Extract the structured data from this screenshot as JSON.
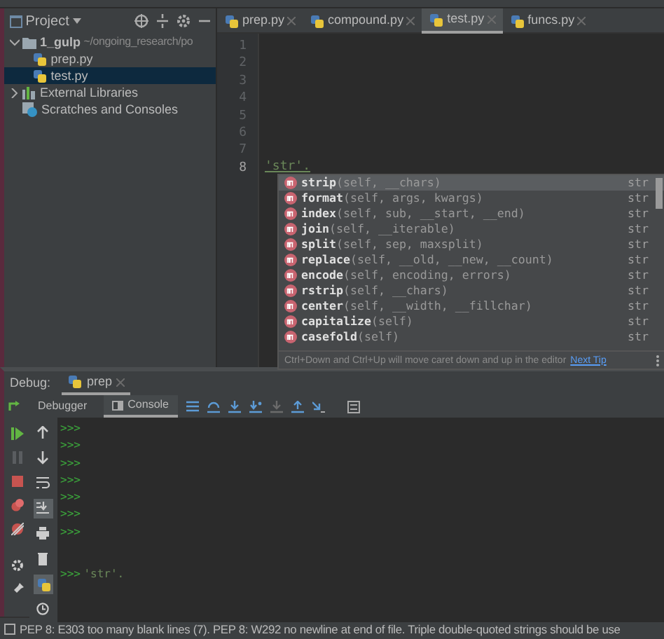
{
  "project_panel": {
    "title": "Project",
    "tree": [
      {
        "label": "1_gulp",
        "path": "~/ongoing_research/po",
        "kind": "folder",
        "expanded": true,
        "selected": false,
        "children": [
          {
            "label": "prep.py",
            "kind": "python",
            "selected": false
          },
          {
            "label": "test.py",
            "kind": "python",
            "selected": true
          }
        ]
      },
      {
        "label": "External Libraries",
        "kind": "library",
        "expanded": false,
        "selected": false
      },
      {
        "label": "Scratches and Consoles",
        "kind": "scratch",
        "selected": false
      }
    ]
  },
  "editor_tabs": [
    {
      "label": "prep.py",
      "selected": false
    },
    {
      "label": "compound.py",
      "selected": false
    },
    {
      "label": "test.py",
      "selected": true
    },
    {
      "label": "funcs.py",
      "selected": false
    }
  ],
  "editor": {
    "line_numbers": [
      "1",
      "2",
      "3",
      "4",
      "5",
      "6",
      "7",
      "8"
    ],
    "code": "'str'."
  },
  "completion": {
    "items": [
      {
        "name": "strip",
        "params": "(self, __chars)",
        "type": "str",
        "selected": true
      },
      {
        "name": "format",
        "params": "(self, args, kwargs)",
        "type": "str",
        "selected": false
      },
      {
        "name": "index",
        "params": "(self, sub, __start, __end)",
        "type": "str",
        "selected": false
      },
      {
        "name": "join",
        "params": "(self, __iterable)",
        "type": "str",
        "selected": false
      },
      {
        "name": "split",
        "params": "(self, sep, maxsplit)",
        "type": "str",
        "selected": false
      },
      {
        "name": "replace",
        "params": "(self, __old, __new, __count)",
        "type": "str",
        "selected": false
      },
      {
        "name": "encode",
        "params": "(self, encoding, errors)",
        "type": "str",
        "selected": false
      },
      {
        "name": "rstrip",
        "params": "(self, __chars)",
        "type": "str",
        "selected": false
      },
      {
        "name": "center",
        "params": "(self, __width, __fillchar)",
        "type": "str",
        "selected": false
      },
      {
        "name": "capitalize",
        "params": "(self)",
        "type": "str",
        "selected": false
      },
      {
        "name": "casefold",
        "params": "(self)",
        "type": "str",
        "selected": false
      }
    ],
    "hint": "Ctrl+Down and Ctrl+Up will move caret down and up in the editor",
    "hint_link": "Next Tip"
  },
  "debug": {
    "label": "Debug:",
    "session": "prep",
    "tabs": [
      {
        "label": "Debugger",
        "selected": false
      },
      {
        "label": "Console",
        "selected": true
      }
    ],
    "console_lines": [
      ">>>",
      ">>>",
      ">>>",
      ">>>",
      ">>>",
      ">>>",
      ">>>"
    ],
    "prompt": ">>>",
    "input": "'str'."
  },
  "status_bar": "PEP 8: E303 too many blank lines (7). PEP 8: W292 no newline at end of file. Triple double-quoted strings should be use"
}
